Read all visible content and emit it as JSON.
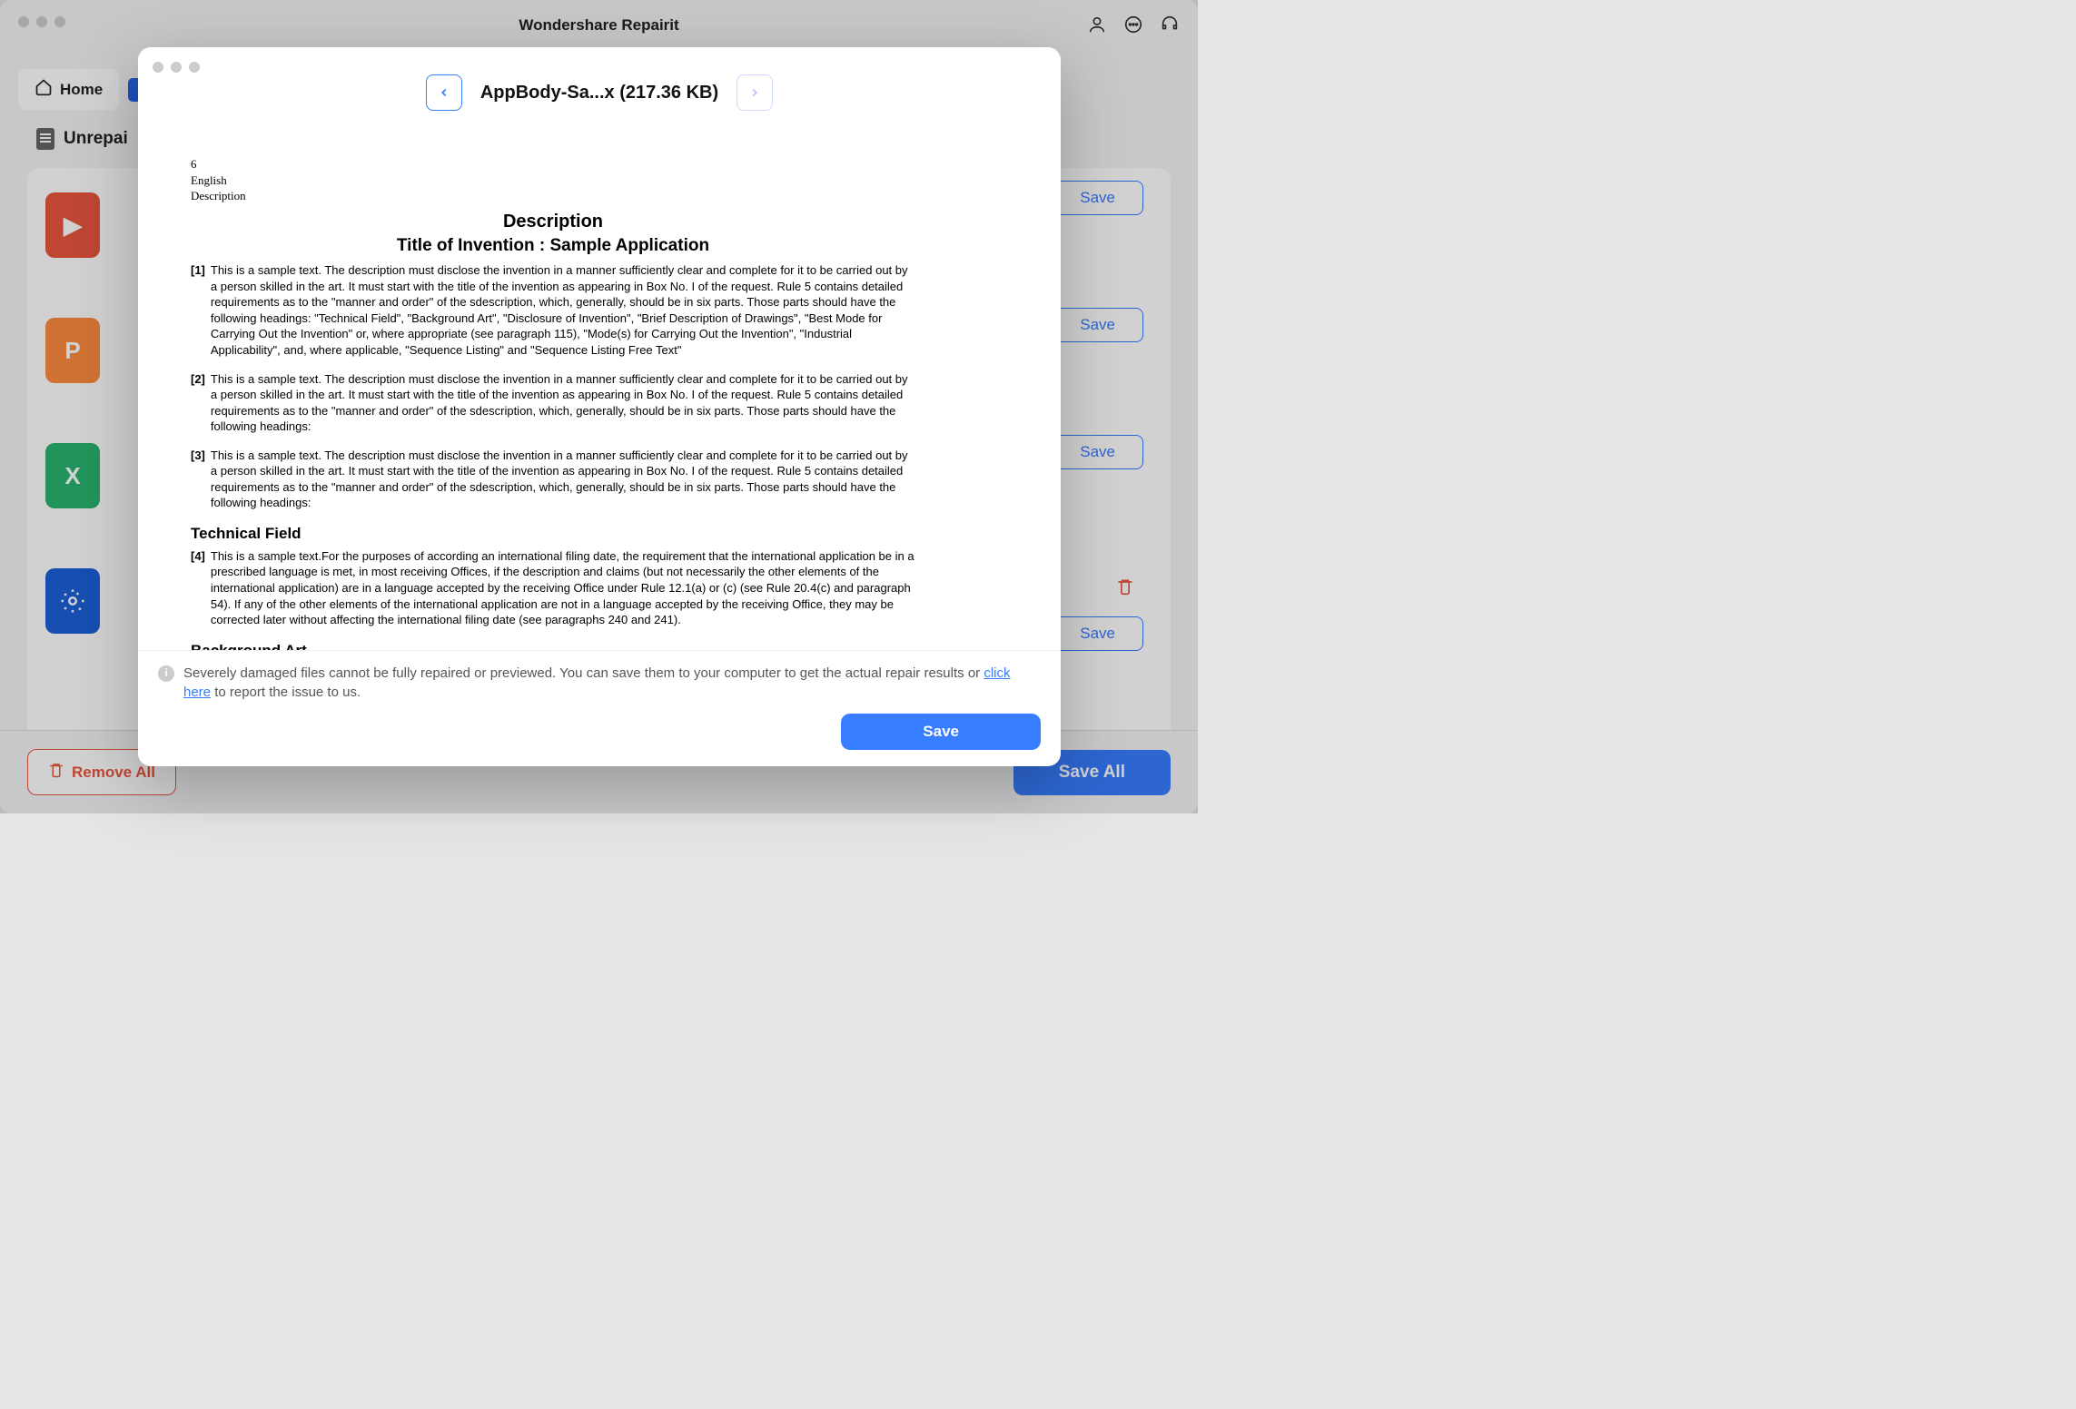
{
  "app": {
    "title": "Wondershare Repairit"
  },
  "toolbar": {
    "home_label": "Home"
  },
  "section": {
    "unrepaired_label": "Unrepai"
  },
  "row_save_label": "Save",
  "bottom": {
    "remove_all": "Remove All",
    "save_all": "Save All"
  },
  "modal": {
    "file_title": "AppBody-Sa...x (217.36 KB)",
    "footer_note_1": "Severely damaged files cannot be fully repaired or previewed. You can save them to your computer to get the actual repair results or ",
    "footer_link": "click here",
    "footer_note_2": " to report the issue to us.",
    "save_label": "Save"
  },
  "doc": {
    "page_num": "6",
    "lang": "English",
    "section_label": "Description",
    "heading1": "Description",
    "heading2": "Title of Invention : Sample Application",
    "p1": "This is a sample text. The description must disclose the invention in a manner sufficiently clear and complete for it to be carried out by a person skilled in the art. It must start with the title of the invention as appearing in Box No. I of the request. Rule 5 contains detailed requirements as to the \"manner and order\" of the sdescription, which, generally, should be in six parts. Those parts should have the following headings: \"Technical Field\", \"Background Art\", \"Disclosure of Invention\", \"Brief Description of Drawings\", \"Best Mode for Carrying Out the Invention\" or, where appropriate (see paragraph 115), \"Mode(s) for Carrying Out the Invention\", \"Industrial Applicability\", and, where applicable, \"Sequence Listing\" and \"Sequence Listing Free Text\"",
    "p2": "This is a sample text. The description must disclose the invention in a manner sufficiently clear and complete for it to be carried out by a person skilled in the art. It must start with the title of the invention as appearing in Box No. I of the request. Rule 5 contains detailed requirements as to the \"manner and order\" of the sdescription, which, generally, should be in six parts. Those parts should have the following headings:",
    "p3": "This is a sample text. The description must disclose the invention in a manner sufficiently clear and complete for it to be carried out by a person skilled in the art. It must start with the title of the invention as appearing in Box No. I of the request. Rule 5 contains detailed requirements as to the \"manner and order\" of the sdescription, which, generally, should be in six parts. Those parts should have the following headings:",
    "sec_tech": "Technical Field",
    "p4": "This is a sample text.For the purposes of according an international filing date, the requirement that the international application be in a prescribed language is met, in most receiving Offices, if the description and claims (but not necessarily the other elements of the international application) are in a language accepted by the receiving Office under Rule 12.1(a) or (c) (see Rule 20.4(c) and paragraph 54). If any of the other elements of the international application are not in a language accepted by the receiving Office, they may be corrected later without affecting the international filing date (see paragraphs 240 and 241).",
    "sec_bg": "Background Art",
    "n1": "[1]",
    "n2": "[2]",
    "n3": "[3]",
    "n4": "[4]"
  }
}
